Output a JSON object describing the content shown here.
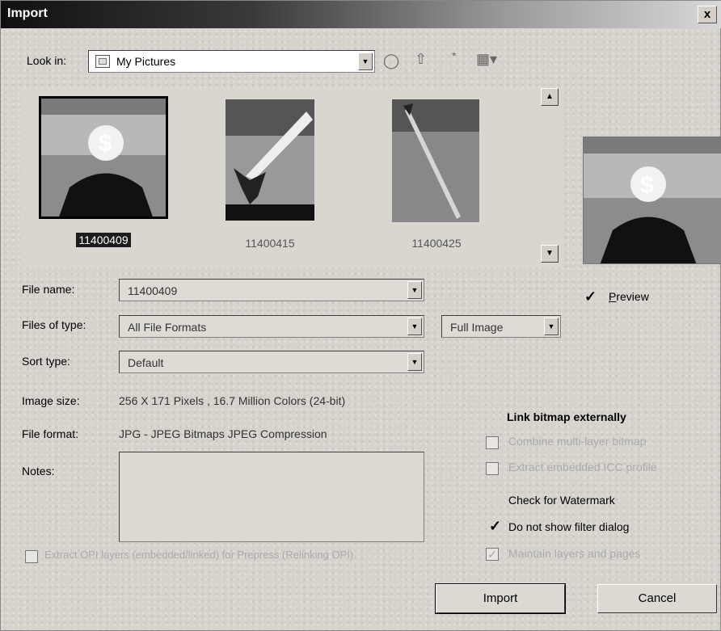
{
  "title": "Import",
  "close_label": "x",
  "look_in": {
    "label": "Look in:",
    "value": "My Pictures"
  },
  "files": [
    {
      "name": "11400409",
      "selected": true
    },
    {
      "name": "11400415",
      "selected": false
    },
    {
      "name": "11400425",
      "selected": false
    }
  ],
  "preview_label": "Preview",
  "preview_checked": true,
  "file_name": {
    "label": "File name:",
    "value": "11400409"
  },
  "files_of_type": {
    "label": "Files of type:",
    "value": "All File Formats"
  },
  "import_mode": {
    "value": "Full Image"
  },
  "sort_type": {
    "label": "Sort type:",
    "value": "Default"
  },
  "image_size": {
    "label": "Image size:",
    "value": "256 X 171 Pixels , 16.7 Million Colors (24-bit)"
  },
  "file_format": {
    "label": "File format:",
    "value": "JPG - JPEG Bitmaps JPEG Compression"
  },
  "notes_label": "Notes:",
  "options": {
    "link_bitmap": "Link bitmap externally",
    "combine_multilayer": "Combine multi-layer bitmap",
    "extract_icc": "Extract embedded ICC profile",
    "check_watermark": "Check for Watermark",
    "no_filter_dialog": "Do not show filter dialog",
    "maintain_layers": "Maintain layers and pages",
    "do_not_show_filter_dialog_checked": true,
    "maintain_layers_checked": true
  },
  "bottom_left_option": "Extract OPI layers (embedded/linked) for Prepress (Relinking OPI)",
  "buttons": {
    "import": "Import",
    "cancel": "Cancel"
  },
  "colors": {
    "title_start": "#101010",
    "title_end": "#d8d8d8",
    "dialog_bg": "#d6d3cc"
  }
}
